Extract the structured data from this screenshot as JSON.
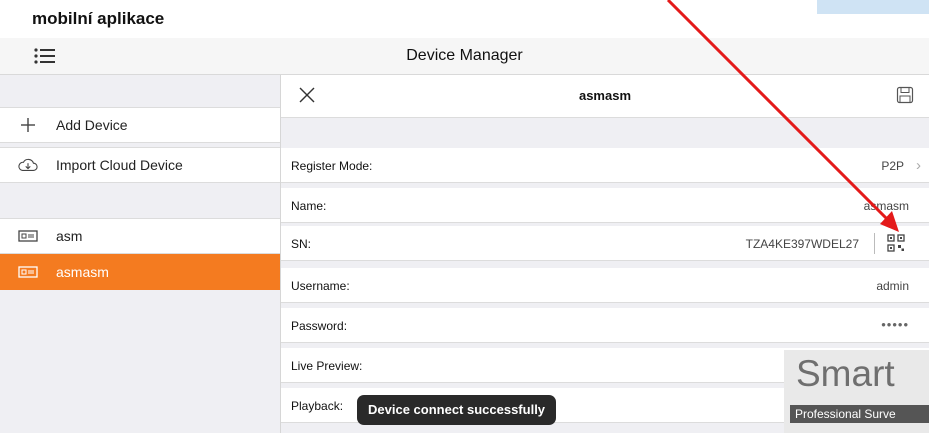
{
  "caption": "mobilní aplikace",
  "topbar": {
    "title": "Device Manager",
    "menu_icon": "list-icon"
  },
  "sidebar": {
    "add_device": "Add Device",
    "import_cloud": "Import Cloud Device",
    "devices": [
      {
        "label": "asm",
        "active": false
      },
      {
        "label": "asmasm",
        "active": true
      }
    ]
  },
  "detail": {
    "title": "asmasm",
    "fields": {
      "register_mode": {
        "label": "Register Mode:",
        "value": "P2P"
      },
      "name": {
        "label": "Name:",
        "value": "asmasm"
      },
      "sn": {
        "label": "SN:",
        "value": "TZA4KE397WDEL27"
      },
      "username": {
        "label": "Username:",
        "value": "admin"
      },
      "password": {
        "label": "Password:",
        "value": "•••••"
      },
      "live_preview": {
        "label": "Live Preview:"
      },
      "playback": {
        "label": "Playback:"
      }
    }
  },
  "toast": "Device connect successfully",
  "watermark": {
    "title": "Smart",
    "subtitle": "Professional Surve"
  },
  "colors": {
    "accent": "#f47b20",
    "annotation": "#e41a1a",
    "toast_bg": "#2a2a2a"
  }
}
